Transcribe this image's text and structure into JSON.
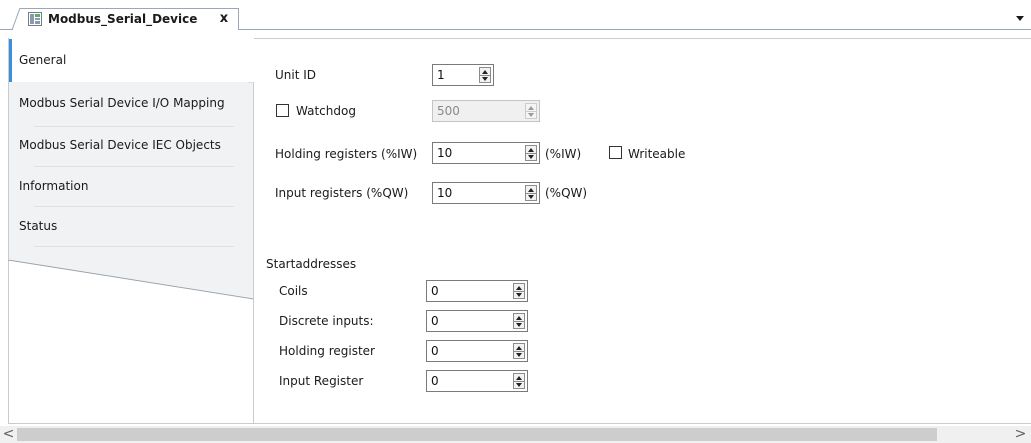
{
  "document_tab": {
    "title": "Modbus_Serial_Device",
    "close_glyph": "x",
    "icon": "device-icon"
  },
  "sidebar": {
    "items": [
      {
        "label": "General",
        "active": true
      },
      {
        "label": "Modbus Serial Device I/O Mapping",
        "active": false
      },
      {
        "label": "Modbus Serial Device IEC Objects",
        "active": false
      },
      {
        "label": "Information",
        "active": false
      },
      {
        "label": "Status",
        "active": false
      }
    ]
  },
  "general": {
    "unit_id": {
      "label": "Unit ID",
      "value": "1"
    },
    "watchdog": {
      "label": "Watchdog",
      "checked": false,
      "value": "500",
      "enabled": false
    },
    "holding_registers": {
      "label": "Holding registers (%IW)",
      "value": "10",
      "suffix": "(%IW)"
    },
    "writeable": {
      "label": "Writeable",
      "checked": false
    },
    "input_registers": {
      "label": "Input registers (%QW)",
      "value": "10",
      "suffix": "(%QW)"
    },
    "start_addresses": {
      "title": "Startaddresses",
      "rows": [
        {
          "label": "Coils",
          "value": "0"
        },
        {
          "label": "Discrete inputs:",
          "value": "0"
        },
        {
          "label": "Holding register",
          "value": "0"
        },
        {
          "label": "Input Register",
          "value": "0"
        }
      ]
    }
  },
  "colors": {
    "active_tab_marker": "#3c8fd9",
    "border": "#9ba7b7"
  },
  "scrollbar": {
    "left_glyph": "<",
    "right_glyph": ">"
  }
}
